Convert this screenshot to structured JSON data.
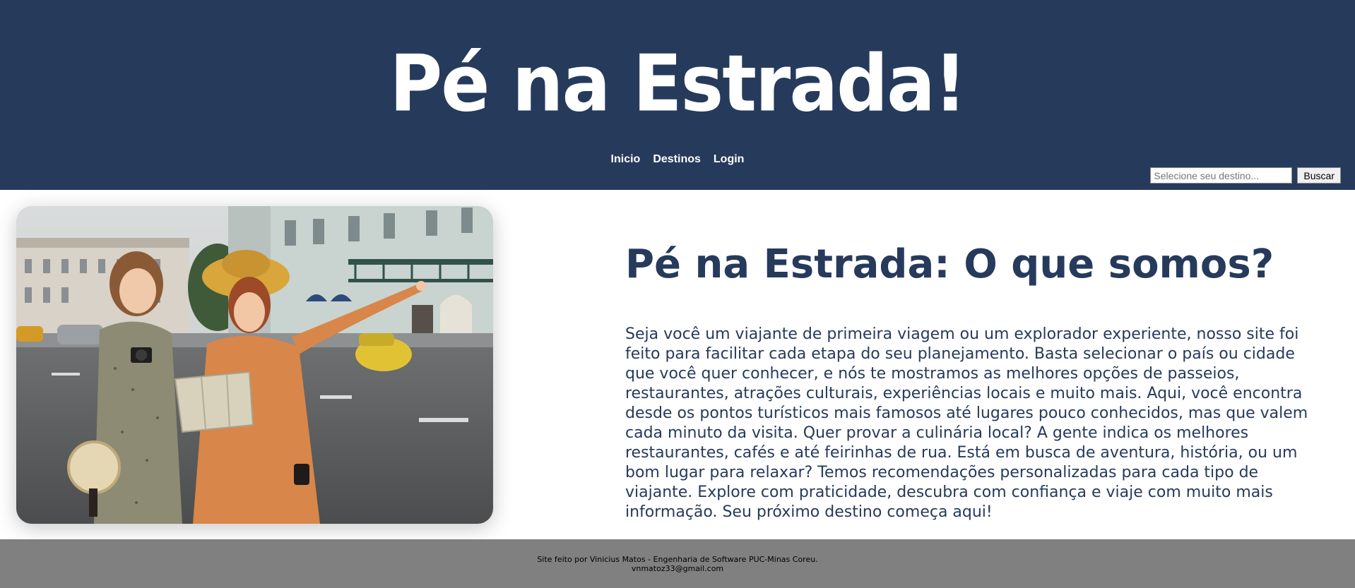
{
  "header": {
    "logo": "Pé na Estrada!",
    "nav": [
      "Inicio",
      "Destinos",
      "Login"
    ],
    "search": {
      "placeholder": "Selecione seu destino...",
      "button": "Buscar"
    },
    "background_color": "#263a5c"
  },
  "about": {
    "title": "Pé na Estrada: O que somos?",
    "body": "Seja você um viajante de primeira viagem ou um explorador experiente, nosso site foi feito para facilitar cada etapa do seu planejamento. Basta selecionar o país ou cidade que você quer conhecer, e nós te mostramos as melhores opções de passeios, restaurantes, atrações culturais, experiências locais e muito mais. Aqui, você encontra desde os pontos turísticos mais famosos até lugares pouco conhecidos, mas que valem cada minuto da visita. Quer provar a culinária local? A gente indica os melhores restaurantes, cafés e até feirinhas de rua. Está em busca de aventura, história, ou um bom lugar para relaxar? Temos recomendações personalizadas para cada tipo de viajante. Explore com praticidade, descubra com confiança e viaje com muito mais informação. Seu próximo destino começa aqui!",
    "text_color": "#263a5c"
  },
  "footer": {
    "credit": "Site feito por Vinicius Matos - Engenharia de Software PUC-Minas Coreu.",
    "email": "vnmatoz33@gmail.com",
    "background_color": "#808080"
  }
}
